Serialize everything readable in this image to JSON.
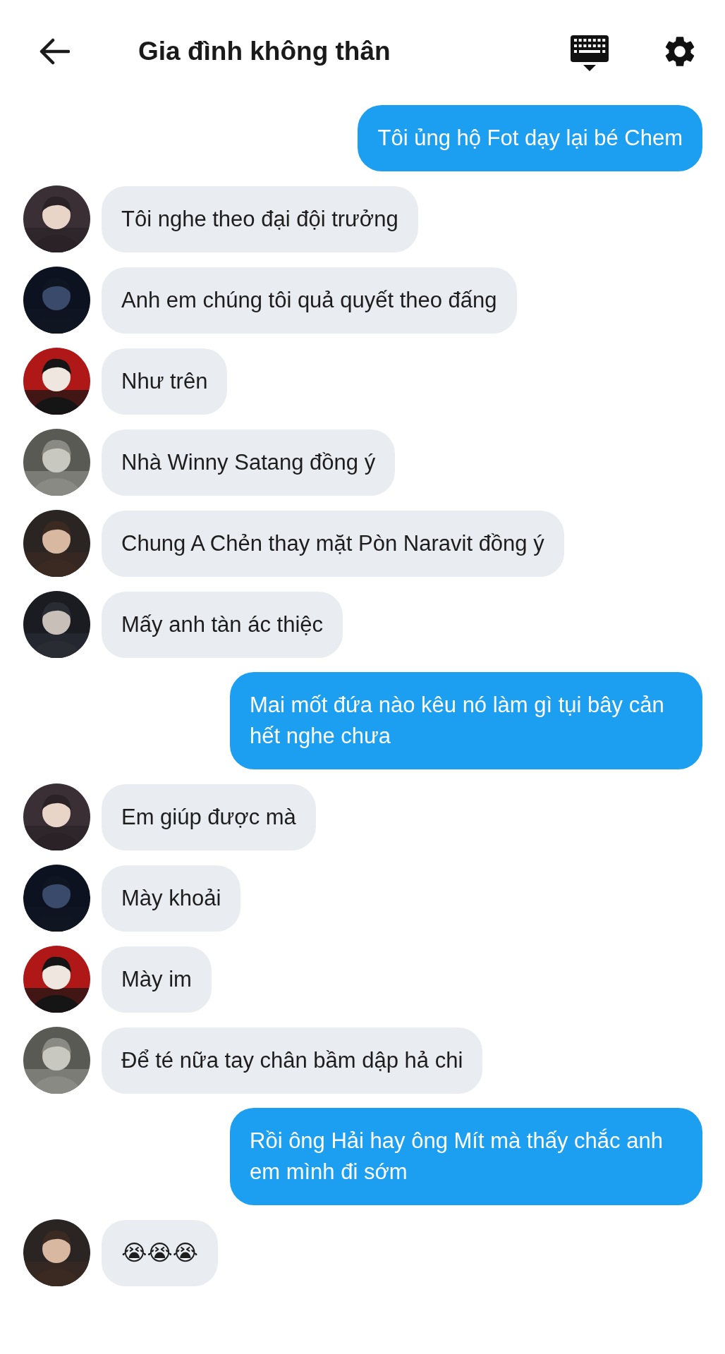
{
  "header": {
    "title": "Gia đình không thân"
  },
  "messages": [
    {
      "kind": "sent",
      "text": "Tôi ủng hộ Fot dạy lại bé Chem"
    },
    {
      "kind": "received",
      "text": "Tôi nghe theo đại đội trưởng"
    },
    {
      "kind": "received",
      "text": "Anh em chúng tôi quả quyết theo đấng"
    },
    {
      "kind": "received",
      "text": "Như trên"
    },
    {
      "kind": "received",
      "text": "Nhà Winny Satang đồng ý"
    },
    {
      "kind": "received",
      "text": "Chung A Chẻn thay mặt Pòn Naravit đồng ý"
    },
    {
      "kind": "received",
      "text": "Mấy anh tàn ác thiệc"
    },
    {
      "kind": "sent",
      "text": "Mai mốt đứa nào kêu nó làm gì tụi bây cản hết nghe chưa"
    },
    {
      "kind": "received",
      "text": "Em giúp được mà"
    },
    {
      "kind": "received",
      "text": "Mày khoải"
    },
    {
      "kind": "received",
      "text": "Mày im"
    },
    {
      "kind": "received",
      "text": "Để té nữa tay chân bầm dập hả chi"
    },
    {
      "kind": "sent",
      "text": "Rồi ông Hải hay ông Mít mà thấy chắc anh em mình đi sớm"
    },
    {
      "kind": "received",
      "text": "😭😭😭"
    }
  ]
}
